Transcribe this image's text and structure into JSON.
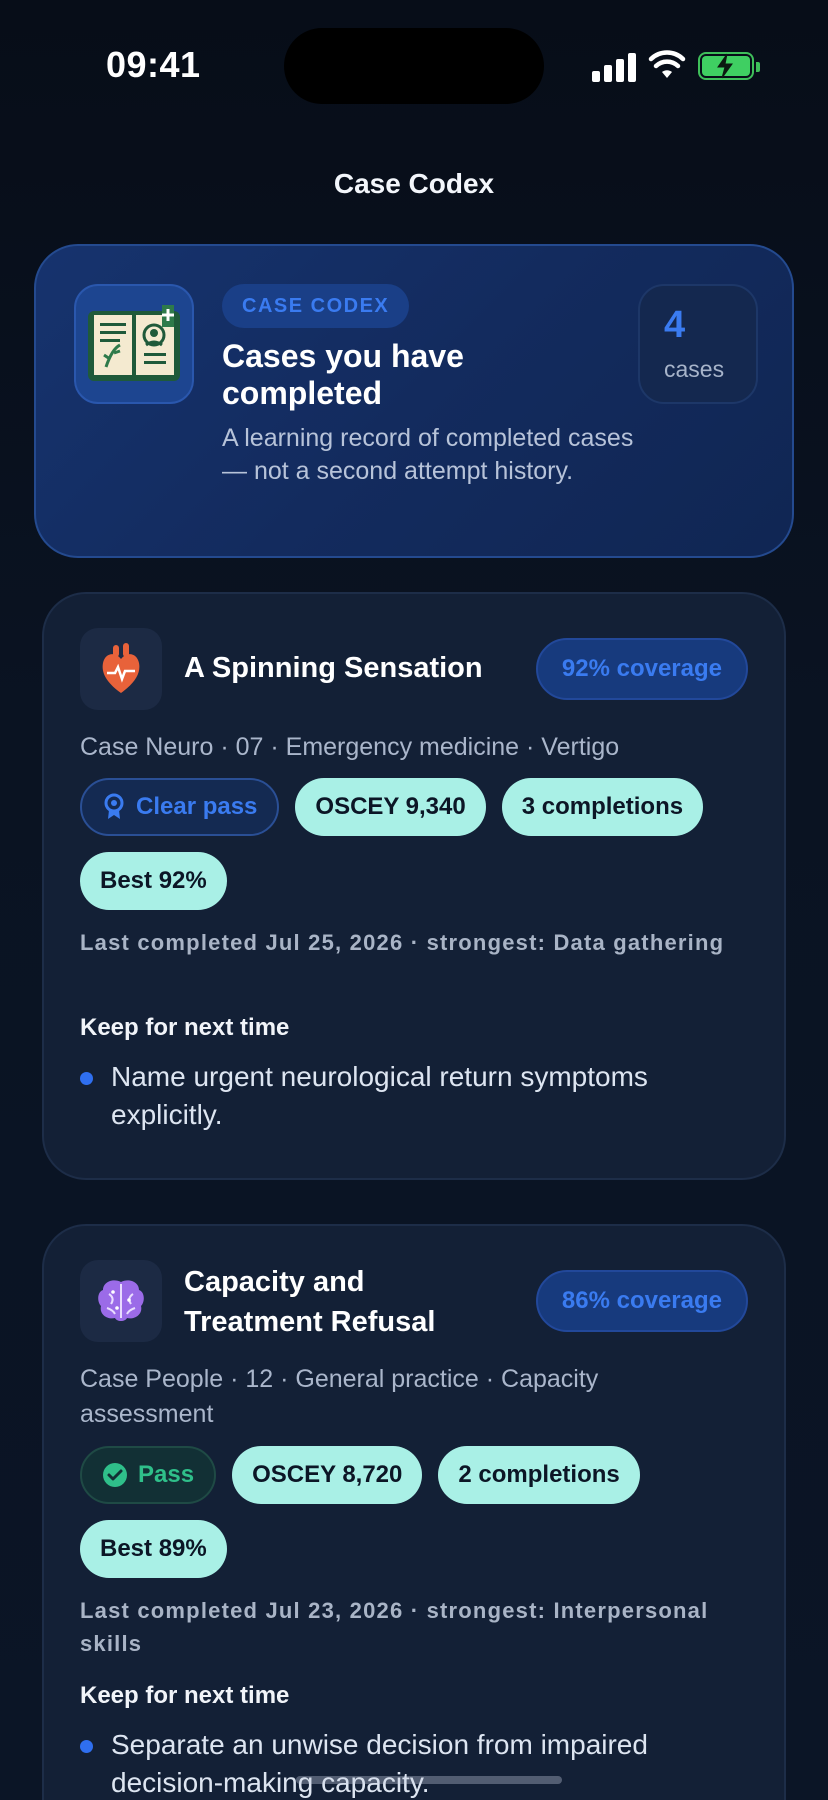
{
  "status_bar": {
    "time": "09:41"
  },
  "nav": {
    "title": "Case Codex"
  },
  "hero": {
    "badge": "CASE CODEX",
    "title": "Cases you have completed",
    "subtitle": "A learning record of completed cases — not a second attempt history.",
    "count": "4",
    "count_label": "cases"
  },
  "cases": [
    {
      "title": "A Spinning Sensation",
      "icon": "heart-icon",
      "coverage": "92% coverage",
      "meta": "Case Neuro · 07 · Emergency medicine · Vertigo",
      "status": "Clear pass",
      "osce": "OSCEY 9,340",
      "completions": "3 completions",
      "best": "Best 92%",
      "last": "Last completed Jul 25, 2026 · strongest: Data gathering",
      "keep_title": "Keep for next time",
      "keep_items": [
        "Name urgent neurological return symptoms explicitly."
      ]
    },
    {
      "title": "Capacity and Treatment Refusal",
      "icon": "brain-icon",
      "coverage": "86% coverage",
      "meta": "Case People · 12 · General practice · Capacity assessment",
      "status": "Pass",
      "osce": "OSCEY 8,720",
      "completions": "2 completions",
      "best": "Best 89%",
      "last": "Last completed Jul 23, 2026 · strongest: Interpersonal skills",
      "keep_title": "Keep for next time",
      "keep_items": [
        "Separate an unwise decision from impaired decision-making capacity."
      ]
    }
  ],
  "colors": {
    "accent": "#3a7bf0",
    "pill": "#a9f0e6",
    "pass": "#2fbf8a",
    "background": "#0b1220"
  }
}
